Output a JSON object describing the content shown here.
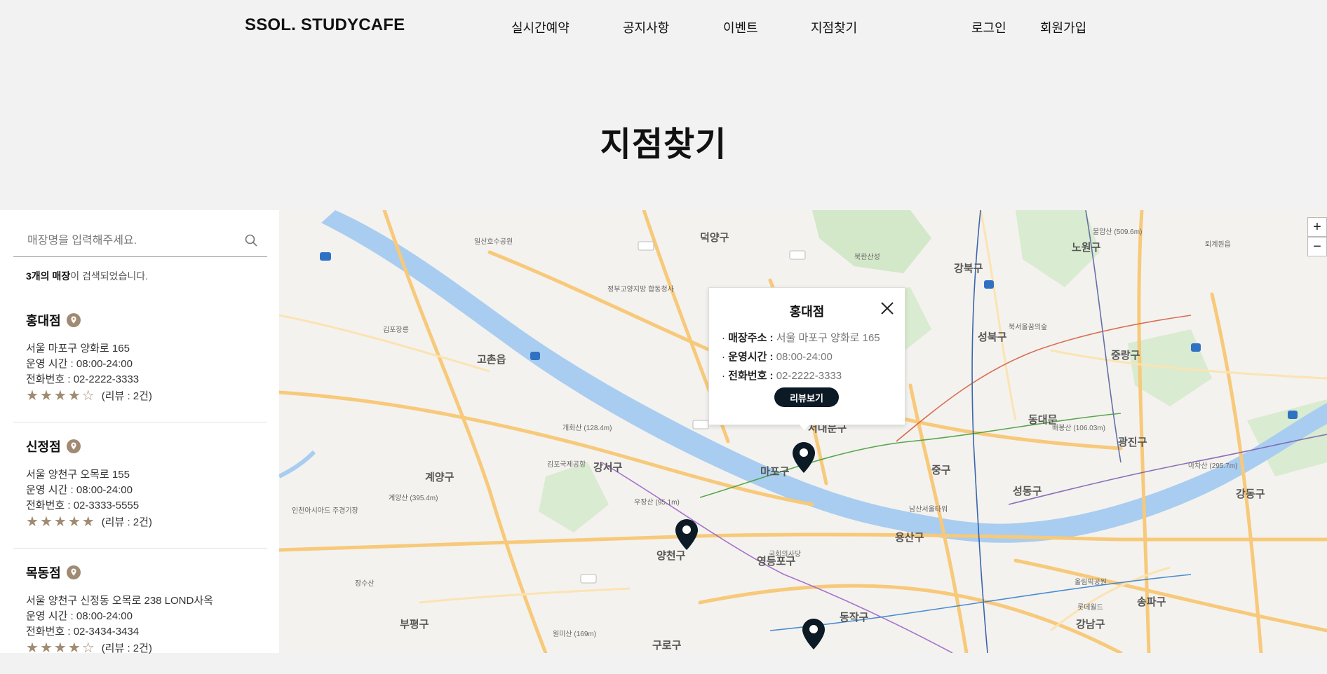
{
  "header": {
    "logo": "SSOL. STUDYCAFE",
    "nav": [
      "실시간예약",
      "공지사항",
      "이벤트",
      "지점찾기"
    ],
    "login": "로그인",
    "signup": "회원가입"
  },
  "page_title": "지점찾기",
  "search": {
    "placeholder": "매장명을 입력해주세요."
  },
  "result": {
    "count_bold": "3개의 매장",
    "count_rest": "이 검색되었습니다."
  },
  "stores": [
    {
      "name": "홍대점",
      "address": "서울 마포구 양화로 165",
      "hours": "운영 시간 : 08:00-24:00",
      "phone": "전화번호 : 02-2222-3333",
      "rating": 4,
      "reviews": "(리뷰 : 2건)"
    },
    {
      "name": "신정점",
      "address": "서울 양천구 오목로 155",
      "hours": "운영 시간 : 08:00-24:00",
      "phone": "전화번호 : 02-3333-5555",
      "rating": 5,
      "reviews": "(리뷰 : 2건)"
    },
    {
      "name": "목동점",
      "address": "서울 양천구 신정동 오목로 238 LOND사옥",
      "hours": "운영 시간 : 08:00-24:00",
      "phone": "전화번호 : 02-3434-3434",
      "rating": 4,
      "reviews": "(리뷰 : 2건)"
    }
  ],
  "popup": {
    "title": "홍대점",
    "address_key": "매장주소 :",
    "address_val": "서울 마포구 양화로 165",
    "hours_key": "운영시간 :",
    "hours_val": "08:00-24:00",
    "phone_key": "전화번호 :",
    "phone_val": "02-2222-3333",
    "button": "리뷰보기"
  },
  "map": {
    "zoom_in": "+",
    "zoom_out": "−",
    "districts": [
      "덕양구",
      "노원구",
      "강북구",
      "성북구",
      "동대문",
      "중랑구",
      "서대문구",
      "마포구",
      "중구",
      "성동구",
      "광진구",
      "강동구",
      "용산구",
      "송파구",
      "강남구",
      "동작구",
      "영등포구",
      "양천구",
      "강서구",
      "계양구",
      "부평구",
      "구로구",
      "고촌읍"
    ],
    "places": [
      "북한산성",
      "불암산 (509.6m)",
      "퇴계원읍",
      "일산호수공원",
      "정부고양지방 합동청사",
      "김포장릉",
      "북서울꿈의숲",
      "개화산 (128.4m)",
      "김포국제공항",
      "계양산 (395.4m)",
      "인천아시아드 주경기장",
      "우장산 (95.1m)",
      "국회의사당",
      "남산서울타워",
      "롯데월드",
      "올림픽공원",
      "아차산 (295.7m)",
      "원미산 (169m)",
      "장수산",
      "배봉산 (106.03m)"
    ]
  },
  "colors": {
    "accent_star": "#a08a72",
    "button_dark": "#0b1a24",
    "river": "#a8cdf0",
    "road": "#f7c97a",
    "park": "#cfe6c4"
  }
}
